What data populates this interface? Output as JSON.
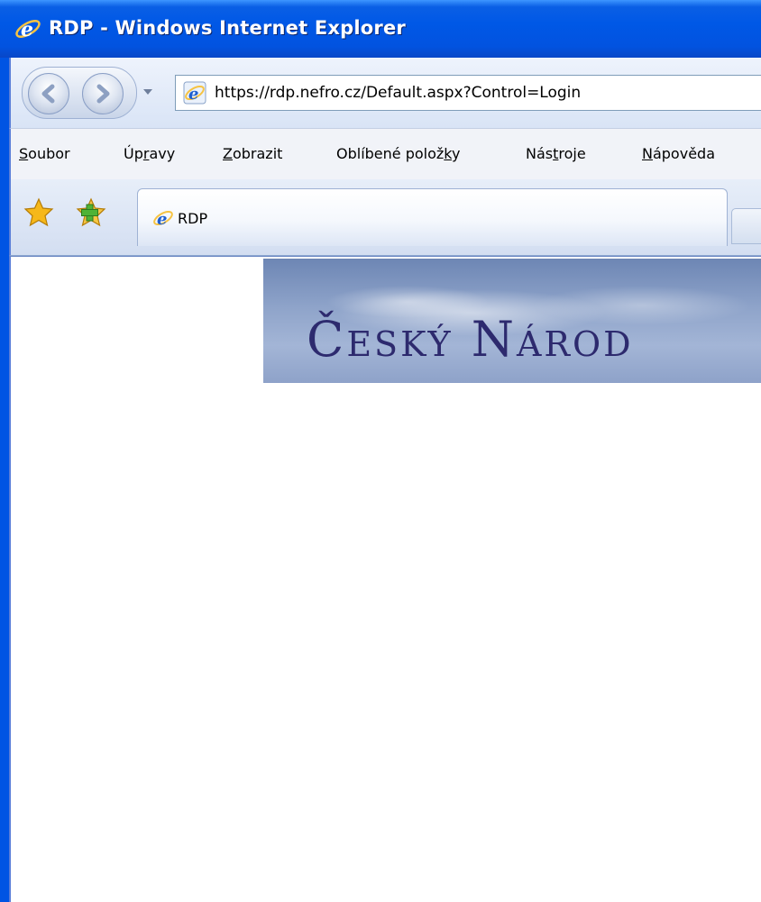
{
  "window": {
    "title": "RDP - Windows Internet Explorer"
  },
  "address_bar": {
    "url": "https://rdp.nefro.cz/Default.aspx?Control=Login"
  },
  "menu": {
    "items": [
      {
        "label_pre": "",
        "label_key": "S",
        "label_post": "oubor"
      },
      {
        "label_pre": "Úp",
        "label_key": "r",
        "label_post": "avy"
      },
      {
        "label_pre": "",
        "label_key": "Z",
        "label_post": "obrazit"
      },
      {
        "label_pre": "Oblíbené polož",
        "label_key": "k",
        "label_post": "y"
      },
      {
        "label_pre": "Nás",
        "label_key": "t",
        "label_post": "roje"
      },
      {
        "label_pre": "",
        "label_key": "N",
        "label_post": "ápověda"
      }
    ]
  },
  "tabs": [
    {
      "label": "RDP"
    }
  ],
  "page": {
    "banner_title": "Český Národ"
  },
  "icons": {
    "title": "ie-icon",
    "back": "back-arrow-icon",
    "forward": "forward-arrow-icon",
    "favorites": "star-icon",
    "add_favorite": "add-favorite-icon"
  },
  "colors": {
    "titlebar": "#0058e6",
    "banner_text": "#2d2a6e"
  }
}
